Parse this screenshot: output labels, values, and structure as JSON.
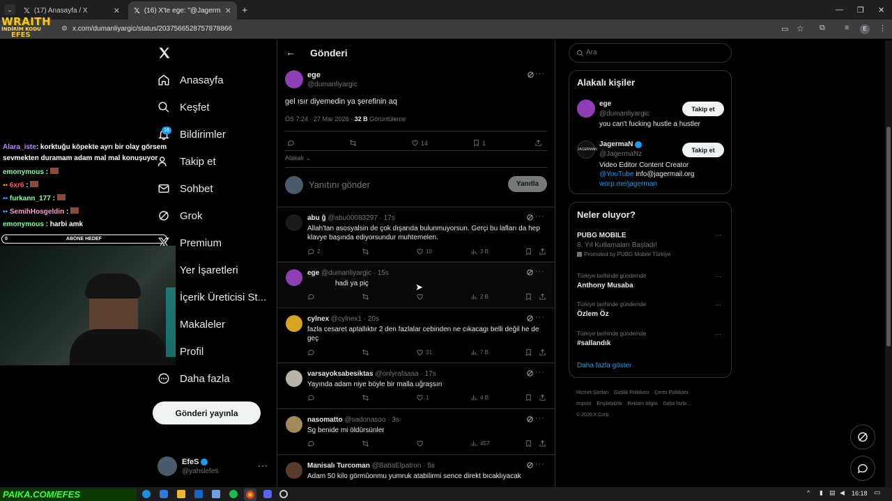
{
  "browser": {
    "tabs": [
      {
        "title": "(17) Anasayfa / X"
      },
      {
        "title": "(16) X'te ege: \"@JagermaNz ge"
      }
    ],
    "url": "x.com/dumanliyargic/status/2037566528757878866",
    "profile_initial": "E"
  },
  "overlay": {
    "logo_main": "WRAITH",
    "logo_sub": "İNDİRİM KODU",
    "logo_code": "EFES",
    "bottom_text": "PAIKA.COM/EFES",
    "goal_label": "ABONE HEDEF",
    "goal_value": "0"
  },
  "chat": [
    {
      "user": "Alara_iste",
      "color": "#b58cff",
      "text": ": korktuğu köpekte ayrı bir olay görsem"
    },
    {
      "user": "",
      "color": "#ffffff",
      "text": "sevmekten duramam adam mal mal konuşuyor"
    },
    {
      "user": "emonymous",
      "color": "#7dffa0",
      "text": " :"
    },
    {
      "user": "6xr6",
      "color": "#ff5a5a",
      "text": " :"
    },
    {
      "user": "furkann_177",
      "color": "#7dffa0",
      "text": " :"
    },
    {
      "user": "SemihHosgeldin",
      "color": "#ff9ad5",
      "text": " :"
    },
    {
      "user": "emonymous",
      "color": "#7dffa0",
      "text": " : harbi amk"
    }
  ],
  "nav": {
    "items": [
      {
        "label": "Anasayfa",
        "icon": "home-icon"
      },
      {
        "label": "Keşfet",
        "icon": "search-icon"
      },
      {
        "label": "Bildirimler",
        "icon": "bell-icon",
        "badge": "16"
      },
      {
        "label": "Takip et",
        "icon": "follow-icon"
      },
      {
        "label": "Sohbet",
        "icon": "mail-icon"
      },
      {
        "label": "Grok",
        "icon": "grok-icon"
      },
      {
        "label": "Premium",
        "icon": "premium-icon"
      },
      {
        "label": "Yer İşaretleri",
        "icon": "bookmark-icon"
      },
      {
        "label": "İçerik Üreticisi St...",
        "icon": "creator-icon"
      },
      {
        "label": "Makaleler",
        "icon": "article-icon"
      },
      {
        "label": "Profil",
        "icon": "profile-icon"
      },
      {
        "label": "Daha fazla",
        "icon": "more-icon"
      }
    ],
    "post_button": "Gönderi yayınla",
    "user_name": "EfeS",
    "user_handle": "@yahslefes"
  },
  "main": {
    "title": "Gönderi",
    "post": {
      "name": "ege",
      "handle": "@dumanliyargic",
      "text": "gel ısır diyemedin ya şerefinin aq",
      "time": "ÖS 7:24 · 27 Mar 2026 ·",
      "views_num": "32 B",
      "views_label": "Görüntüleme",
      "likes": "14",
      "bookmarks": "1"
    },
    "relevant": "Alakalı",
    "reply_placeholder": "Yanıtını gönder",
    "reply_button": "Yanıtla",
    "replies": [
      {
        "name": "abu ğ",
        "handle": "@abu00083297 · 17s",
        "text": "Allah'tan asosyalsin de çok dışarıda bulunmuyorsun. Gerçi bu lafları da hep klavye başında ediyorsundur muhtemelen.",
        "replies": "2",
        "likes": "10",
        "views": "3 B",
        "avatar": "#1a1a1a"
      },
      {
        "name": "ege",
        "handle": "@dumanliyargic · 15s",
        "text": "hadi ya piç",
        "replies": "",
        "likes": "",
        "views": "2 B",
        "avatar": "#8e3fb5"
      },
      {
        "name": "cylnex",
        "handle": "@cylnex1 · 20s",
        "text": "fazla cesaret aptallıktır 2 den fazlalar cebinden ne cıkacagı belli değil he de geç",
        "replies": "",
        "likes": "31",
        "views": "7 B",
        "avatar": "#d9a521"
      },
      {
        "name": "varsayoksabesiktas",
        "handle": "@onlyrafaaaa · 17s",
        "text": "Yayında adam niye böyle bir malla uğraşsın",
        "replies": "",
        "likes": "1",
        "views": "4 B",
        "avatar": "#b9b3a8"
      },
      {
        "name": "nasomatto",
        "handle": "@sadonasoo · 3s",
        "text": "Sg benide mi öldürsünler",
        "replies": "",
        "likes": "",
        "views": "457",
        "avatar": "#a08a5a"
      },
      {
        "name": "Manisalı Turcoman",
        "handle": "@BabaElpatron · 5s",
        "text": "Adam 50 kilo görmûonmu yumruk atabilirmi sence direkt bıcaklıyacak",
        "replies": "",
        "likes": "",
        "views": "",
        "avatar": "#5a3a2a"
      }
    ]
  },
  "right": {
    "search_placeholder": "Ara",
    "relevant_title": "Alakalı kişiler",
    "people": [
      {
        "name": "ege",
        "handle": "@dumanliyargic",
        "bio": "you can't fucking hustle a hustler",
        "button": "Takip et"
      },
      {
        "name": "JagermaN",
        "handle": "@JagermaNz",
        "bio": "Video Editor Content Creator",
        "link1": "@YouTube",
        "mail": "info@jagermail.org",
        "link2": "worp.me/jagerman",
        "button": "Takip et"
      }
    ],
    "trends_title": "Neler oluyor?",
    "trends": [
      {
        "name": "PUBG MOBILE",
        "sub": "8. Yıl Kutlamaları Başladı!",
        "promo": "Promoted by PUBG Mobile Türkiye"
      },
      {
        "context": "Türkiye tarihinde gündemde",
        "name": "Anthony Musaba"
      },
      {
        "context": "Türkiye tarihinde gündemde",
        "name": "Özlem Öz"
      },
      {
        "context": "Türkiye tarihinde gündemde",
        "name": "#sallandık"
      }
    ],
    "show_more": "Daha fazla göster",
    "footer": [
      "Hizmet Şartları",
      "Gizlilik Politikası",
      "Çerez Politikası",
      "Imprint",
      "Erişilebilirlik",
      "Reklam bilgisi",
      "Daha fazla ...",
      "© 2026 X Corp."
    ]
  },
  "taskbar": {
    "time": "16:18"
  },
  "colors": {
    "accent": "#1d9bf0",
    "bg": "#000000",
    "border": "#2f3336",
    "muted": "#71767b",
    "text": "#e7e9ea"
  }
}
